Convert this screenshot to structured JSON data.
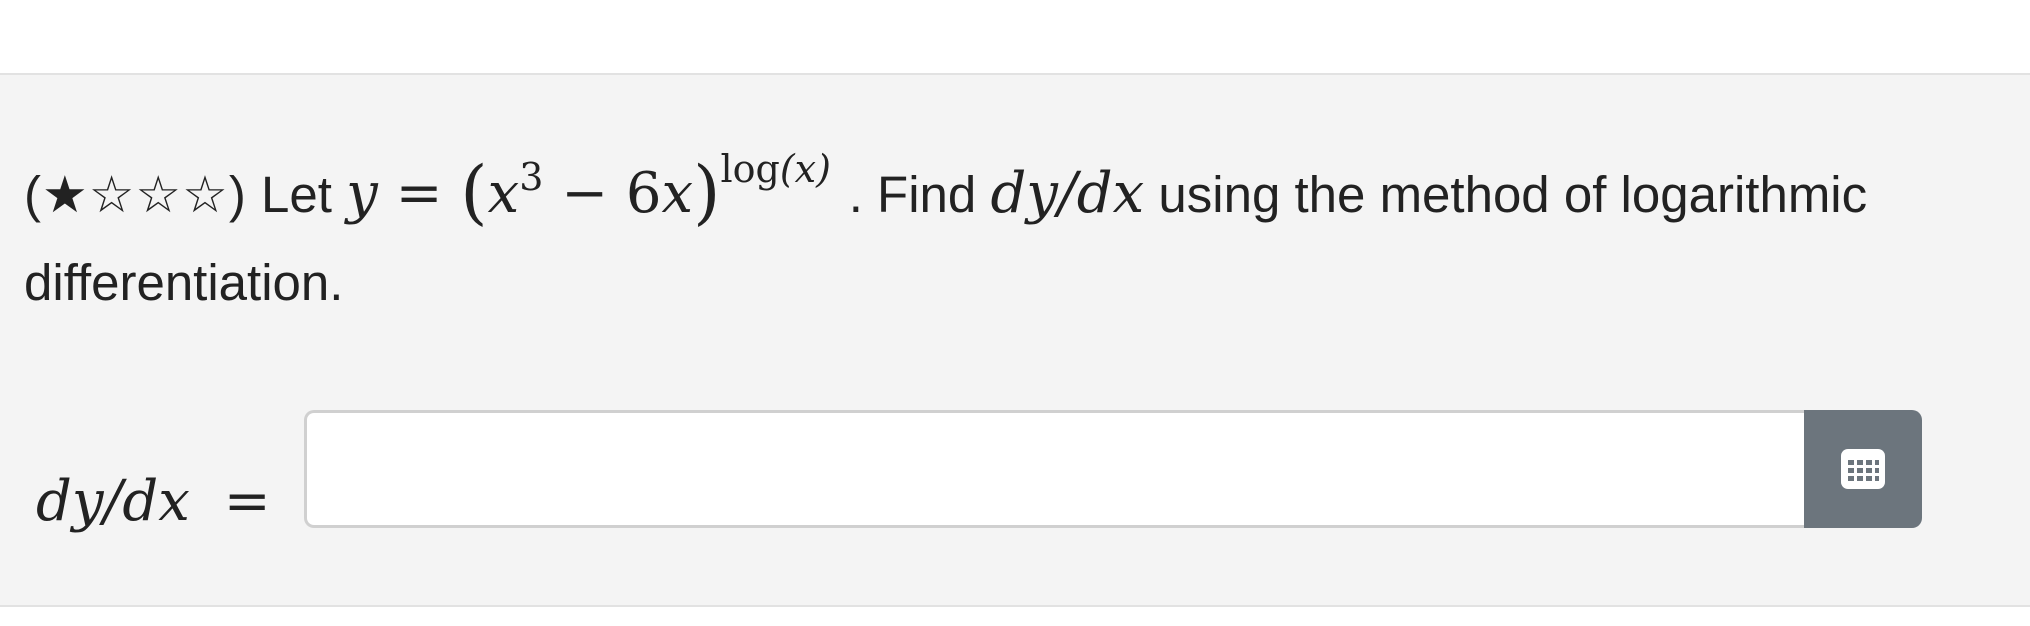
{
  "question": {
    "difficulty_stars": "(★☆☆☆)",
    "text_let": "Let",
    "math_y": "y",
    "math_equals": "=",
    "math_x": "x",
    "math_cube": "3",
    "math_minus_6": " − 6",
    "math_x2": "x",
    "math_exp_log": "log",
    "math_exp_arg": "(x)",
    "text_find": ". Find",
    "math_derivative": "dy/dx",
    "text_rest": "using the method of logarithmic differentiation."
  },
  "answer": {
    "label": "dy/dx",
    "equals": "=",
    "input_value": "",
    "input_placeholder": "",
    "keypad_icon": "keypad-grid-icon"
  },
  "colors": {
    "panel_bg": "#f4f4f4",
    "button_bg": "#6c757d"
  }
}
